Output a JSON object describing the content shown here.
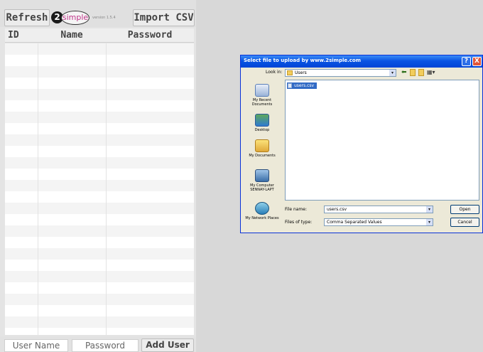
{
  "toolbar": {
    "refresh_label": "Refresh",
    "logo_mark": "2",
    "logo_text": "simple",
    "version_text": "version 1.5.4",
    "import_label": "Import CSV"
  },
  "table": {
    "columns": [
      "ID",
      "Name",
      "Password"
    ]
  },
  "footer": {
    "user_name_placeholder": "User Name",
    "password_placeholder": "Password",
    "add_user_label": "Add User"
  },
  "dialog": {
    "title": "Select file to upload by www.2simple.com",
    "look_in_label": "Look in:",
    "look_in_value": "Users",
    "places": [
      "My Recent Documents",
      "Desktop",
      "My Documents",
      "My Computer SENNAY-LAPT",
      "My Network Places"
    ],
    "files": [
      "users.csv"
    ],
    "file_name_label": "File name:",
    "file_name_value": "users.csv",
    "file_type_label": "Files of type:",
    "file_type_value": "Comma Separated Values",
    "open_label": "Open",
    "cancel_label": "Cancel",
    "help_glyph": "?",
    "close_glyph": "X"
  },
  "colors": {
    "titlebar": "#0a54e3",
    "selection": "#316ac5",
    "page_background": "#d8d8d8",
    "panel_background": "#e4e4e4"
  },
  "icons": [
    "back-arrow-icon",
    "up-folder-icon",
    "new-folder-icon",
    "views-menu-icon",
    "recent-documents-icon",
    "desktop-icon",
    "my-documents-icon",
    "my-computer-icon",
    "network-places-icon",
    "csv-file-icon",
    "folder-icon"
  ]
}
